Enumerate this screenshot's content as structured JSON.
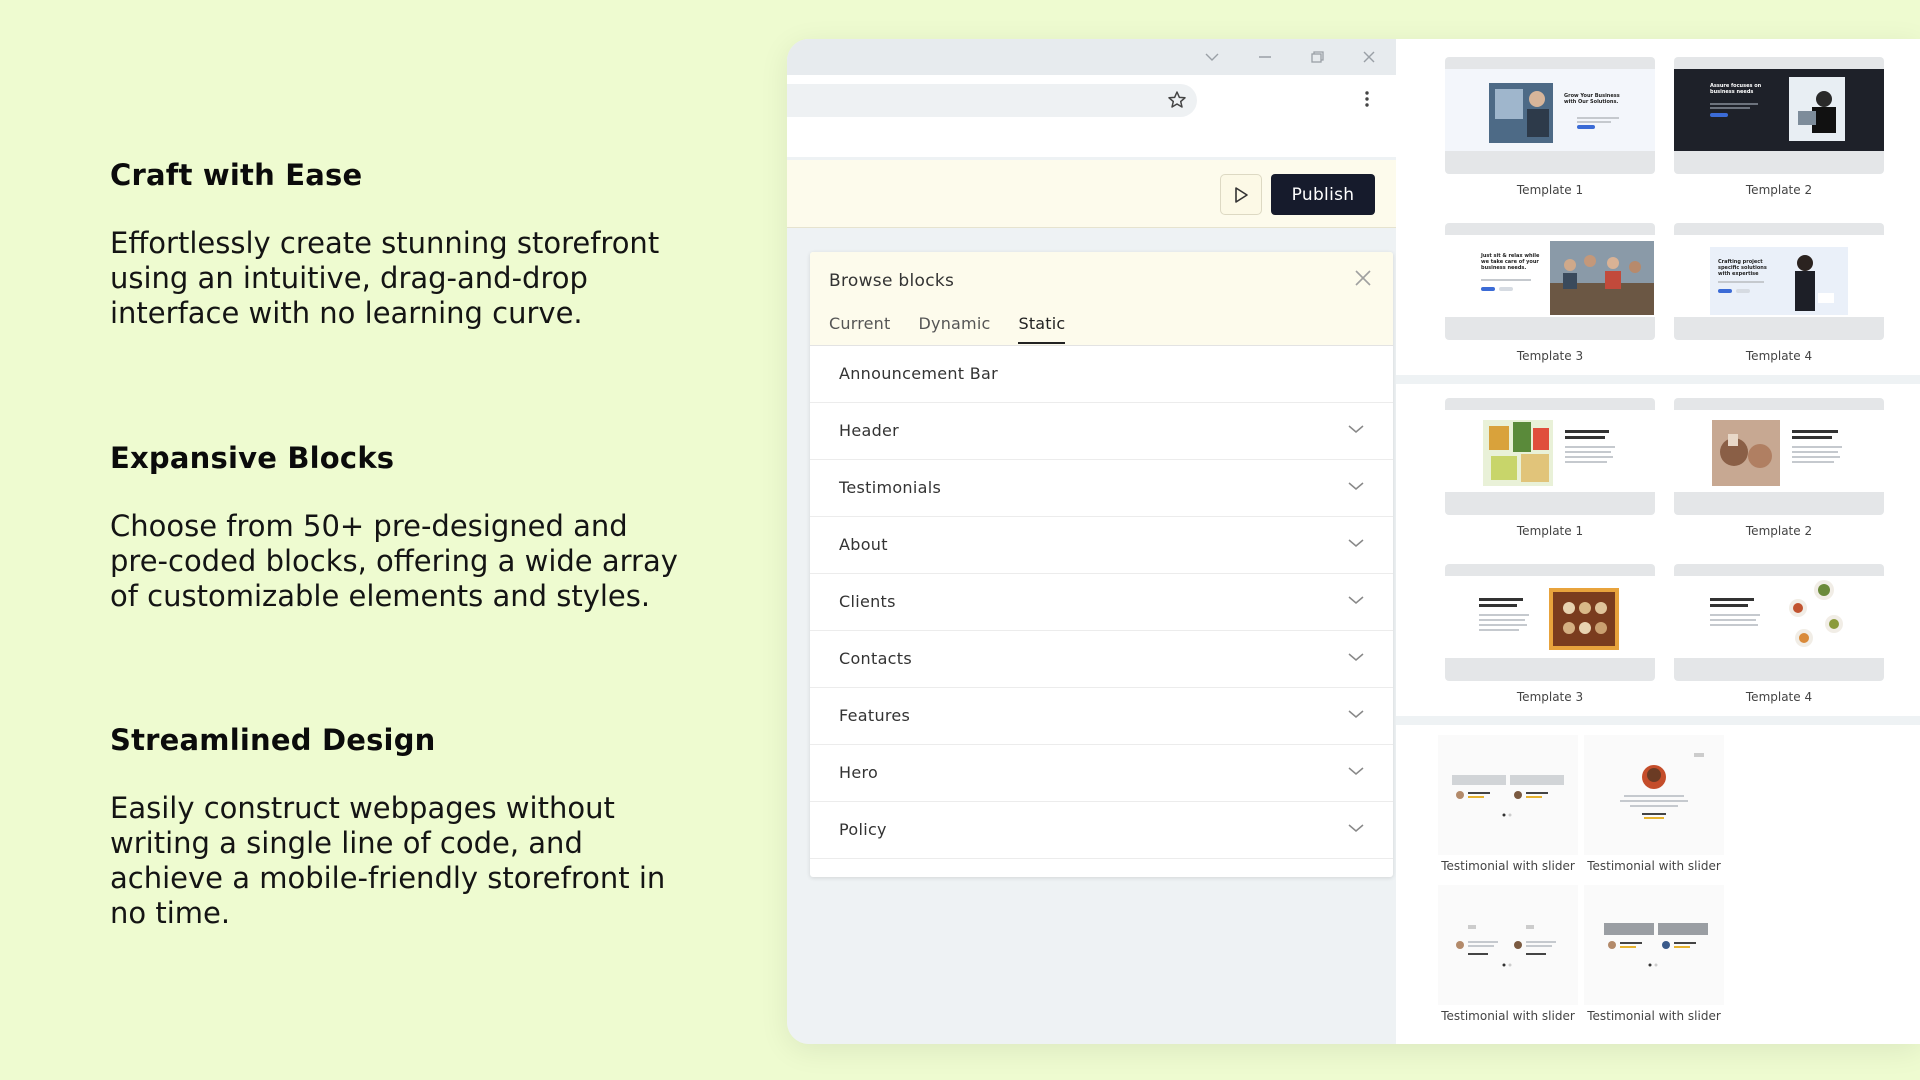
{
  "features": [
    {
      "title": "Craft with Ease",
      "lines": [
        "Effortlessly create stunning storefront",
        "using an intuitive, drag-and-drop",
        "interface with no learning curve."
      ]
    },
    {
      "title": "Expansive Blocks",
      "lines": [
        "Choose from 50+ pre-designed and",
        "pre-coded blocks, offering a wide array",
        "of customizable elements and styles."
      ]
    },
    {
      "title": "Streamlined Design",
      "lines": [
        "Easily construct webpages without",
        "writing a single line of code, and",
        "achieve a mobile-friendly storefront in",
        "no time."
      ]
    }
  ],
  "window": {
    "controls": {
      "chevron": "chevron-down-icon",
      "minimize": "minimize-icon",
      "restore": "restore-icon",
      "close": "close-icon"
    },
    "toolbar": {
      "publish_label": "Publish",
      "preview_icon": "play-icon"
    }
  },
  "panel": {
    "title": "Browse blocks",
    "tabs": [
      {
        "label": "Current",
        "active": false
      },
      {
        "label": "Dynamic",
        "active": false
      },
      {
        "label": "Static",
        "active": true
      }
    ],
    "items": [
      {
        "label": "Announcement Bar",
        "expandable": false
      },
      {
        "label": "Header",
        "expandable": true
      },
      {
        "label": "Testimonials",
        "expandable": true
      },
      {
        "label": "About",
        "expandable": true
      },
      {
        "label": "Clients",
        "expandable": true
      },
      {
        "label": "Contacts",
        "expandable": true
      },
      {
        "label": "Features",
        "expandable": true
      },
      {
        "label": "Hero",
        "expandable": true
      },
      {
        "label": "Policy",
        "expandable": true
      }
    ]
  },
  "gallery": {
    "hero_templates": [
      "Template 1",
      "Template 2",
      "Template 3",
      "Template 4"
    ],
    "about_templates": [
      "Template 1",
      "Template 2",
      "Template 3",
      "Template 4"
    ],
    "testimonials": [
      "Testimonial with slider",
      "Testimonial with slider",
      "Testimonial with slider",
      "Testimonial with slider"
    ],
    "hero_preview_texts": [
      "Grow Your Business with Our Solutions.",
      "Assure focuses on business needs",
      "Just sit & relax while we take care of your business needs.",
      "Crafting project specific solutions with expertise"
    ]
  },
  "colors": {
    "page_bg": "#eefbd0",
    "publish_bg": "#161b2c",
    "toolbar_bg": "#fdfbec"
  }
}
